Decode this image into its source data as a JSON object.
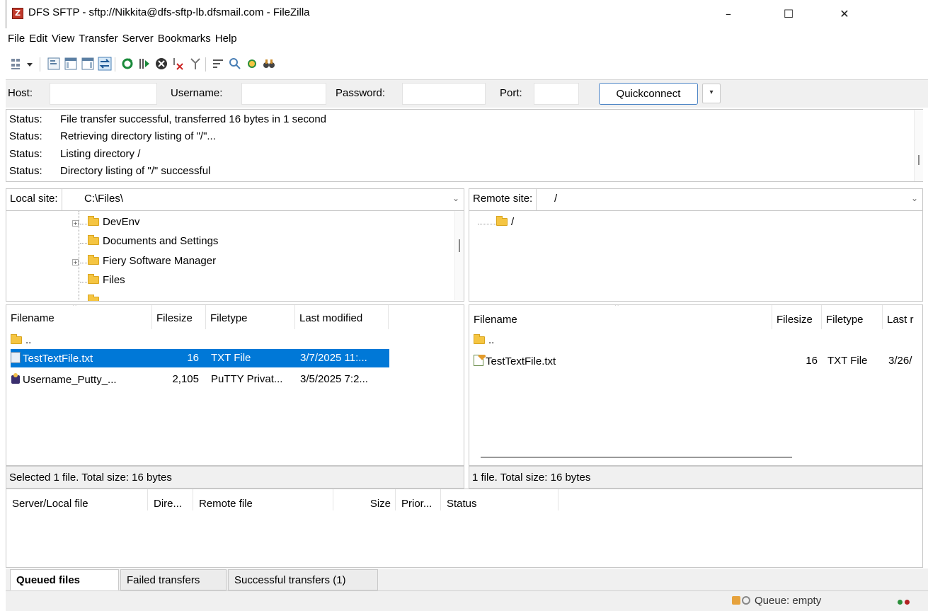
{
  "window": {
    "title": "DFS SFTP - sftp://Nikkita@dfs-sftp-lb.dfsmail.com - FileZilla",
    "icon_letter": "Z",
    "minimize": "–",
    "maximize": "☐",
    "close": "✕"
  },
  "menu": [
    "File",
    "Edit",
    "View",
    "Transfer",
    "Server",
    "Bookmarks",
    "Help"
  ],
  "toolbar": {
    "icons": [
      "site-manager-icon",
      "dropdown-arrow-icon",
      "toggle-message-log-icon",
      "toggle-local-tree-icon",
      "toggle-remote-tree-icon",
      "toggle-transfer-queue-icon",
      "refresh-icon",
      "process-queue-icon",
      "cancel-icon",
      "disconnect-icon",
      "reconnect-icon",
      "directory-filter-icon",
      "compare-directories-icon",
      "sync-browse-icon",
      "search-files-icon"
    ],
    "colors": {
      "refresh": "#1a8a3a",
      "cancel": "#333333",
      "disconnect": "#cc2222"
    }
  },
  "quickconnect": {
    "host_label": "Host:",
    "username_label": "Username:",
    "password_label": "Password:",
    "port_label": "Port:",
    "host_value": "",
    "username_value": "",
    "password_value": "",
    "port_value": "",
    "button_label": "Quickconnect",
    "dropdown_glyph": "▾"
  },
  "log": [
    {
      "label": "Status:",
      "text": "File transfer successful, transferred 16 bytes in 1 second"
    },
    {
      "label": "Status:",
      "text": "Retrieving directory listing of \"/\"..."
    },
    {
      "label": "Status:",
      "text": "Listing directory /"
    },
    {
      "label": "Status:",
      "text": "Directory listing of \"/\" successful"
    }
  ],
  "local": {
    "site_label": "Local site:",
    "path": "C:\\Files\\",
    "tree": [
      "DevEnv",
      "Documents and Settings",
      "Fiery Software Manager",
      "Files"
    ],
    "columns": [
      "Filename",
      "Filesize",
      "Filetype",
      "Last modified"
    ],
    "parent_dir": "..",
    "files": [
      {
        "name": "TestTextFile.txt",
        "size": "16",
        "type": "TXT File",
        "modified": "3/7/2025 11:...",
        "selected": true
      },
      {
        "name": "Username_Putty_...",
        "size": "2,105",
        "type": "PuTTY Privat...",
        "modified": "3/5/2025 7:2...",
        "selected": false
      }
    ],
    "status": "Selected 1 file. Total size: 16 bytes"
  },
  "remote": {
    "site_label": "Remote site:",
    "path": "/",
    "tree": [
      "/"
    ],
    "columns": [
      "Filename",
      "Filesize",
      "Filetype",
      "Last r"
    ],
    "parent_dir": "..",
    "files": [
      {
        "name": "TestTextFile.txt",
        "size": "16",
        "type": "TXT File",
        "modified": "3/26/"
      }
    ],
    "status": "1 file. Total size: 16 bytes"
  },
  "queue": {
    "columns": [
      "Server/Local file",
      "Dire...",
      "Remote file",
      "Size",
      "Prior...",
      "Status"
    ],
    "tabs": [
      "Queued files",
      "Failed transfers",
      "Successful transfers (1)"
    ],
    "active_tab": 0,
    "status_text": "Queue: empty",
    "indicator_colors": [
      "#2a8f3a",
      "#b22222"
    ]
  }
}
